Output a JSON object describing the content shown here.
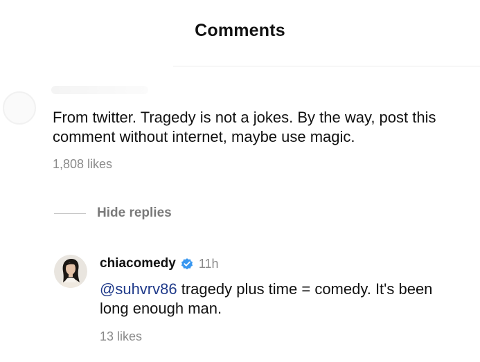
{
  "header": {
    "title": "Comments"
  },
  "parent_comment": {
    "text": "From twitter. Tragedy is not a jokes. By the way, post this comment without internet, maybe use magic.",
    "likes": "1,808 likes"
  },
  "replies_toggle": {
    "label": "Hide replies"
  },
  "reply": {
    "username": "chiacomedy",
    "verified": true,
    "time": "11h",
    "mention": "@suhvrv86",
    "text": " tragedy plus time = comedy. It's been long enough man.",
    "likes": "13 likes",
    "mention_color": "#1f3a8a",
    "verified_color": "#3897f0"
  }
}
